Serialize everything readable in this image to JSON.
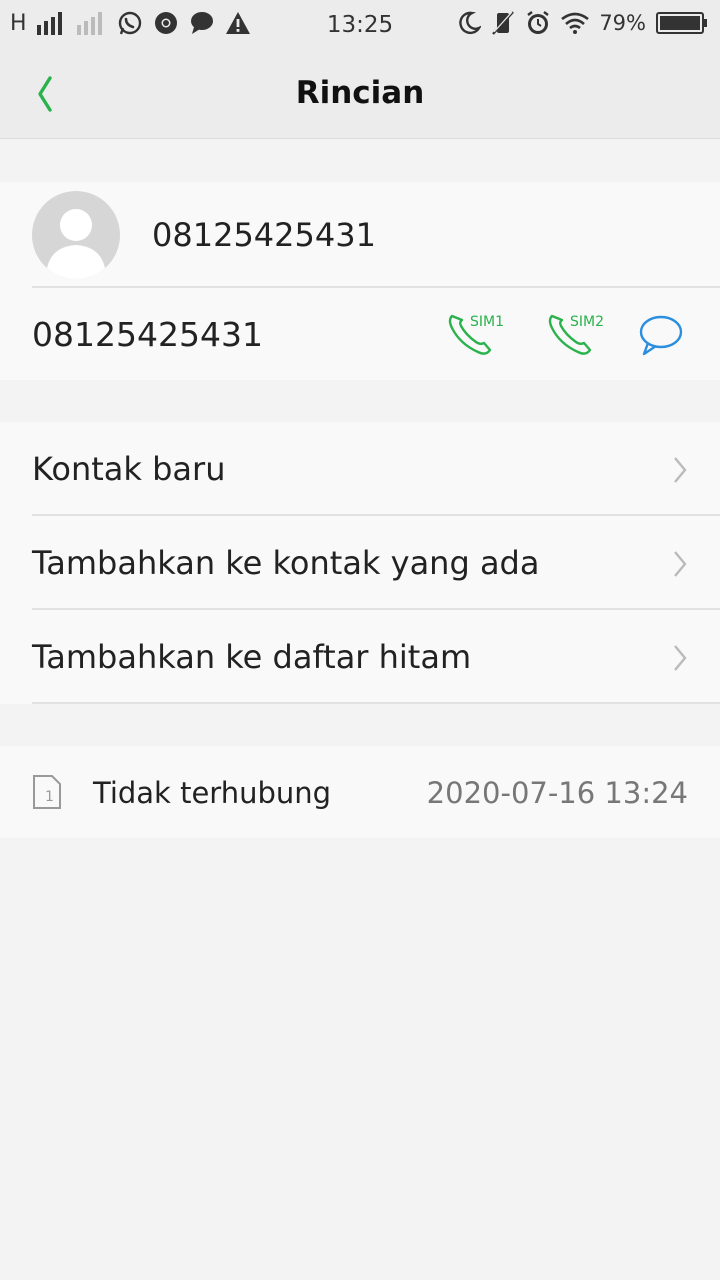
{
  "status_bar": {
    "network_type": "H",
    "time": "13:25",
    "battery": "79%"
  },
  "header": {
    "title": "Rincian"
  },
  "contact": {
    "name": "08125425431",
    "number": "08125425431",
    "sim1_label": "SIM1",
    "sim2_label": "SIM2"
  },
  "options": [
    {
      "label": "Kontak baru"
    },
    {
      "label": "Tambahkan ke kontak yang ada"
    },
    {
      "label": "Tambahkan ke daftar hitam"
    }
  ],
  "call_log": {
    "sim_number": "1",
    "status": "Tidak terhubung",
    "datetime": "2020-07-16 13:24"
  },
  "colors": {
    "accent_green": "#2bb24c",
    "accent_blue": "#2b8fe0"
  },
  "icons": {
    "back": "chevron-left-icon",
    "call": "phone-icon",
    "message": "chat-bubble-icon"
  }
}
